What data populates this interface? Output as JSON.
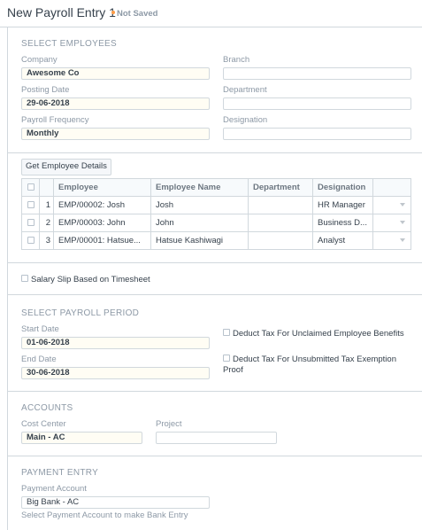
{
  "header": {
    "title": "New Payroll Entry 1",
    "status": "Not Saved"
  },
  "select_employees": {
    "heading": "SELECT EMPLOYEES",
    "company": {
      "label": "Company",
      "value": "Awesome Co"
    },
    "posting_date": {
      "label": "Posting Date",
      "value": "29-06-2018"
    },
    "payroll_frequency": {
      "label": "Payroll Frequency",
      "value": "Monthly"
    },
    "branch": {
      "label": "Branch",
      "value": ""
    },
    "department": {
      "label": "Department",
      "value": ""
    },
    "designation": {
      "label": "Designation",
      "value": ""
    }
  },
  "employees_grid": {
    "get_details_button": "Get Employee Details",
    "columns": [
      "Employee",
      "Employee Name",
      "Department",
      "Designation"
    ],
    "rows": [
      {
        "idx": "1",
        "employee": "EMP/00002: Josh",
        "employee_name": "Josh",
        "department": "",
        "designation": "HR Manager"
      },
      {
        "idx": "2",
        "employee": "EMP/00003: John",
        "employee_name": "John",
        "department": "",
        "designation": "Business D..."
      },
      {
        "idx": "3",
        "employee": "EMP/00001: Hatsue...",
        "employee_name": "Hatsue Kashiwagi",
        "department": "",
        "designation": "Analyst"
      }
    ]
  },
  "timesheet": {
    "label": "Salary Slip Based on Timesheet",
    "checked": false
  },
  "payroll_period": {
    "heading": "SELECT PAYROLL PERIOD",
    "start_date": {
      "label": "Start Date",
      "value": "01-06-2018"
    },
    "end_date": {
      "label": "End Date",
      "value": "30-06-2018"
    },
    "deduct_unclaimed": {
      "label": "Deduct Tax For Unclaimed Employee Benefits",
      "checked": false
    },
    "deduct_unsubmitted": {
      "label": "Deduct Tax For Unsubmitted Tax Exemption Proof",
      "checked": false
    }
  },
  "accounts": {
    "heading": "ACCOUNTS",
    "cost_center": {
      "label": "Cost Center",
      "value": "Main - AC"
    },
    "project": {
      "label": "Project",
      "value": ""
    }
  },
  "payment_entry": {
    "heading": "PAYMENT ENTRY",
    "payment_account": {
      "label": "Payment Account",
      "value": "Big Bank - AC"
    },
    "help": "Select Payment Account to make Bank Entry"
  },
  "colors": {
    "indicator_orange": "#ff9b45",
    "border": "#d1d8dd",
    "muted_text": "#8d99a6",
    "filled_input_bg": "#fffdf4"
  }
}
